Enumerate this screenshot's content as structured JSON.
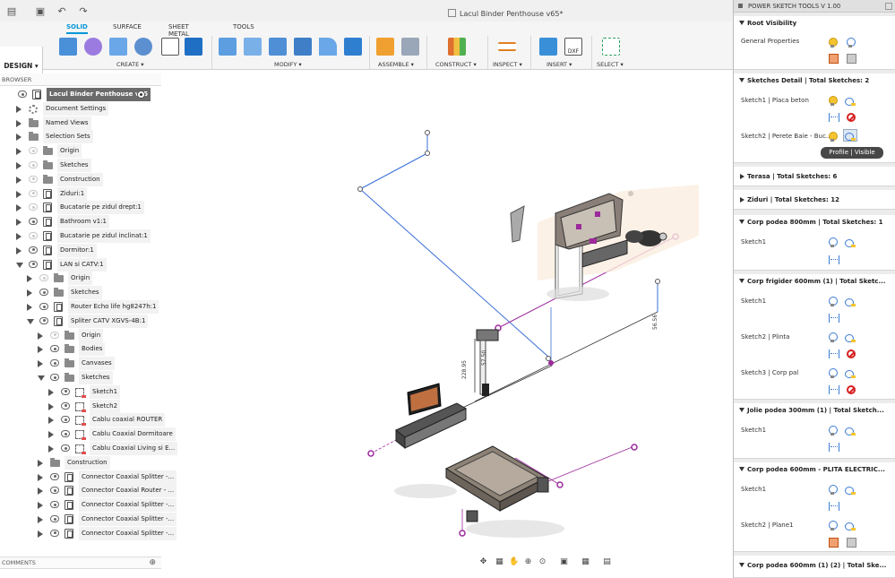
{
  "window": {
    "title": "Lacul Binder Penthouse v65*"
  },
  "toolbar": {
    "design_label": "DESIGN ▾"
  },
  "tabs": [
    {
      "label": "SOLID",
      "active": true
    },
    {
      "label": "SURFACE",
      "active": false
    },
    {
      "label": "SHEET METAL",
      "active": false
    },
    {
      "label": "TOOLS",
      "active": false
    }
  ],
  "groups": [
    "CREATE ▾",
    "MODIFY ▾",
    "ASSEMBLE ▾",
    "CONSTRUCT ▾",
    "INSPECT ▾",
    "INSERT ▾",
    "SELECT ▾"
  ],
  "browser": {
    "header": "BROWSER",
    "comments": "COMMENTS",
    "rows": [
      {
        "label": "Lacul Binder Penthouse v65",
        "depth": 0,
        "icon": "component",
        "eye": true,
        "root": true
      },
      {
        "label": "Document Settings",
        "depth": 1,
        "icon": "gear",
        "eye": false
      },
      {
        "label": "Named Views",
        "depth": 1,
        "icon": "folder",
        "eye": false
      },
      {
        "label": "Selection Sets",
        "depth": 1,
        "icon": "folder",
        "eye": false
      },
      {
        "label": "Origin",
        "depth": 1,
        "icon": "folder",
        "eye": "dim"
      },
      {
        "label": "Sketches",
        "depth": 1,
        "icon": "folder",
        "eye": "dim"
      },
      {
        "label": "Construction",
        "depth": 1,
        "icon": "folder",
        "eye": "dim"
      },
      {
        "label": "Ziduri:1",
        "depth": 1,
        "icon": "component",
        "eye": "dim"
      },
      {
        "label": "Bucatarie pe zidul drept:1",
        "depth": 1,
        "icon": "component",
        "eye": "dim"
      },
      {
        "label": "Bathroom v1:1",
        "depth": 1,
        "icon": "component",
        "eye": true
      },
      {
        "label": "Bucatarie pe zidul inclinat:1",
        "depth": 1,
        "icon": "component",
        "eye": "dim"
      },
      {
        "label": "Dormitor:1",
        "depth": 1,
        "icon": "component",
        "eye": true
      },
      {
        "label": "LAN si CATV:1",
        "depth": 1,
        "icon": "component",
        "eye": true,
        "open": true
      },
      {
        "label": "Origin",
        "depth": 2,
        "icon": "folder",
        "eye": "dim"
      },
      {
        "label": "Sketches",
        "depth": 2,
        "icon": "folder",
        "eye": true
      },
      {
        "label": "Router Echo life hg8247h:1",
        "depth": 2,
        "icon": "component",
        "eye": true
      },
      {
        "label": "Spliter CATV XGVS-4B:1",
        "depth": 2,
        "icon": "component",
        "eye": true,
        "open": true
      },
      {
        "label": "Origin",
        "depth": 3,
        "icon": "folder",
        "eye": "dim"
      },
      {
        "label": "Bodies",
        "depth": 3,
        "icon": "folder",
        "eye": true
      },
      {
        "label": "Canvases",
        "depth": 3,
        "icon": "folder",
        "eye": true
      },
      {
        "label": "Sketches",
        "depth": 3,
        "icon": "folder",
        "eye": true,
        "open": true
      },
      {
        "label": "Sketch1",
        "depth": 4,
        "icon": "sketch",
        "eye": true
      },
      {
        "label": "Sketch2",
        "depth": 4,
        "icon": "sketch",
        "eye": true
      },
      {
        "label": "Cablu coaxial ROUTER",
        "depth": 4,
        "icon": "sketch",
        "eye": true
      },
      {
        "label": "Cablu Coaxial Dormitoare",
        "depth": 4,
        "icon": "sketch",
        "eye": true
      },
      {
        "label": "Cablu Coaxial Living si E...",
        "depth": 4,
        "icon": "sketch",
        "eye": true
      },
      {
        "label": "Construction",
        "depth": 3,
        "icon": "folder",
        "eye": false
      },
      {
        "label": "Connector Coaxial Splitter -...",
        "depth": 3,
        "icon": "component",
        "eye": true
      },
      {
        "label": "Connector Coaxial Router - ...",
        "depth": 3,
        "icon": "component",
        "eye": true
      },
      {
        "label": "Connector Coaxial Splitter -...",
        "depth": 3,
        "icon": "component",
        "eye": true
      },
      {
        "label": "Connector Coaxial Splitter -...",
        "depth": 3,
        "icon": "component",
        "eye": true
      },
      {
        "label": "Connector Coaxial Splitter -...",
        "depth": 3,
        "icon": "component",
        "eye": true
      }
    ]
  },
  "viewport": {
    "dims": [
      "56.56",
      "57.50",
      "228.95"
    ]
  },
  "panel": {
    "title": "POWER SKETCH TOOLS V 1.00",
    "tooltip": "Profile | Visible",
    "sections": [
      {
        "header": "Root Visibility",
        "rows": [
          {
            "label": "General Properties"
          }
        ]
      },
      {
        "header": "Sketches Detail | Total Sketches: 2",
        "rows": [
          {
            "label": "Sketch1 | Placa beton"
          },
          {
            "label": "Sketch2 | Perete Baie - Buc..."
          }
        ]
      },
      {
        "header": "Terasa | Total Sketches: 6",
        "rows": []
      },
      {
        "header": "Ziduri | Total Sketches: 12",
        "rows": []
      },
      {
        "header": "Corp podea 800mm | Total Sketches: 1",
        "rows": [
          {
            "label": "Sketch1"
          }
        ]
      },
      {
        "header": "Corp frigider 600mm (1) | Total Sketc...",
        "rows": [
          {
            "label": "Sketch1"
          },
          {
            "label": "Sketch2 | Plinta"
          },
          {
            "label": "Sketch3 | Corp pal"
          }
        ]
      },
      {
        "header": "Jolie podea 300mm (1) | Total Sketch...",
        "rows": [
          {
            "label": "Sketch1"
          }
        ]
      },
      {
        "header": "Corp podea 600mm - PLITA ELECTRIC...",
        "rows": [
          {
            "label": "Sketch1"
          },
          {
            "label": "Sketch2 | Plane1"
          }
        ]
      },
      {
        "header": "Corp podea 600mm (1) (2) | Total Ske...",
        "rows": []
      }
    ]
  },
  "colors": {
    "accent": "#0696d7",
    "sketch_line": "#3a6fd8",
    "magenta": "#9c2a9c"
  }
}
